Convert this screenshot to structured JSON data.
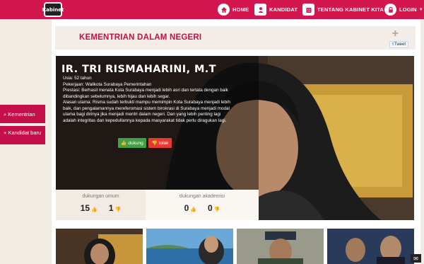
{
  "nav": {
    "logo_text": "Kabinet",
    "items": [
      {
        "label": "HOME",
        "icon": "home-icon"
      },
      {
        "label": "KANDIDAT",
        "icon": "user-icon"
      },
      {
        "label": "TENTANG KABINET KITA",
        "icon": "building-icon"
      },
      {
        "label": "LOGIN",
        "icon": "lock-icon"
      }
    ]
  },
  "sidebar": {
    "items": [
      {
        "label": "Kementrian",
        "icon": "search-icon"
      },
      {
        "label": "Kandidat baru",
        "icon": "plus-icon"
      }
    ]
  },
  "header": {
    "title": "KEMENTRIAN DALAM NEGERI",
    "plus": "+",
    "tweet_label": "Tweet"
  },
  "candidate": {
    "name": "IR. TRI RISMAHARINI, M.T",
    "age": "Usia: 52 tahun",
    "job": "Pekerjaan: Walikota Surabaya Pemerintahan",
    "achievement": "Prestasi: Berhasil menata Kota Surabaya menjadi lebih asri dan tertata dengan baik dibandingkan sebelumnya, lebih hijau dan lebih segar.",
    "reason": "Alasan utama: Risma sudah terbukti mampu memimpin Kota Surabaya menjadi lebih baik, dan pengalamannya mereferomasi sistem birokrasi di Surabaya menjadi modal utama bagi dirinya jika menjadi mentri dalam negeri. Dan yang lebih penting lagi adalah integritas dan kepedulIannya kepada masyarakat tidak perlu diragukan lagi.",
    "upvote_label": "dukung",
    "downvote_label": "tolak"
  },
  "stats": {
    "public_label": "dukungan umum",
    "public_up": "15",
    "public_down": "1",
    "academic_label": "dukungan akademisi",
    "academic_up": "0",
    "academic_down": "0"
  },
  "colors": {
    "brand": "#d4164f",
    "up": "#43a047",
    "down": "#e53935"
  }
}
